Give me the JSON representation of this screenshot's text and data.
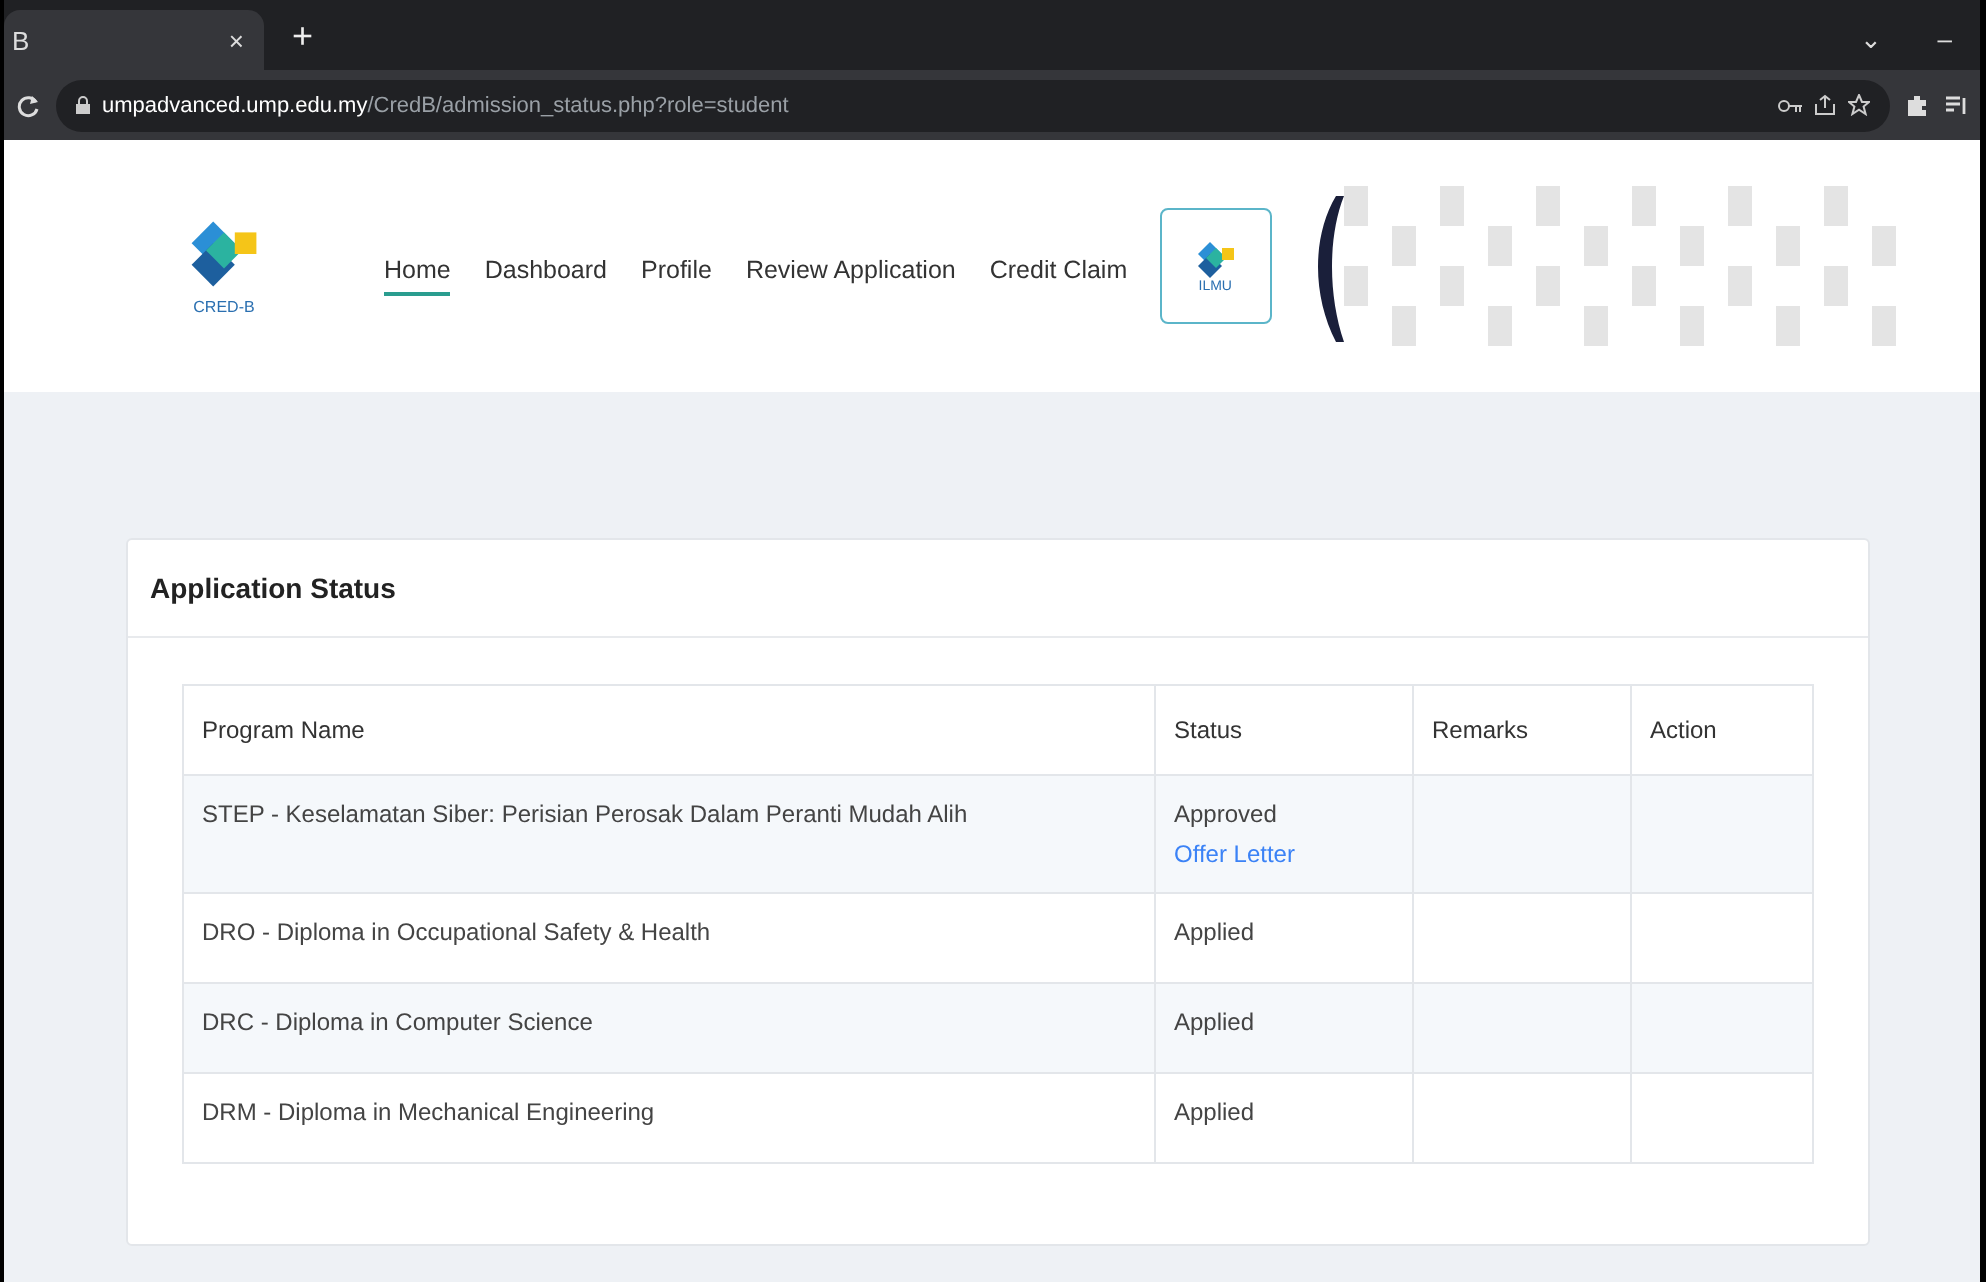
{
  "browser": {
    "tab_title": "B",
    "tab_close": "×",
    "new_tab": "+",
    "url_host": "umpadvanced.ump.edu.my",
    "url_path": "/CredB/admission_status.php?role=student",
    "minimize": "–",
    "chevron": "⌄"
  },
  "header": {
    "logo_text": "CRED-B",
    "nav": [
      {
        "label": "Home",
        "selected": true
      },
      {
        "label": "Dashboard",
        "selected": false
      },
      {
        "label": "Profile",
        "selected": false
      },
      {
        "label": "Review Application",
        "selected": false
      },
      {
        "label": "Credit Claim",
        "selected": false
      }
    ],
    "ilmu_label": "ILMU"
  },
  "card": {
    "title": "Application Status",
    "columns": [
      "Program Name",
      "Status",
      "Remarks",
      "Action"
    ],
    "rows": [
      {
        "program": "STEP - Keselamatan Siber: Perisian Perosak Dalam Peranti Mudah Alih",
        "status": "Approved",
        "link": "Offer Letter"
      },
      {
        "program": "DRO - Diploma in Occupational Safety & Health",
        "status": "Applied"
      },
      {
        "program": "DRC - Diploma in Computer Science",
        "status": "Applied"
      },
      {
        "program": "DRM - Diploma in Mechanical Engineering",
        "status": "Applied"
      }
    ]
  }
}
